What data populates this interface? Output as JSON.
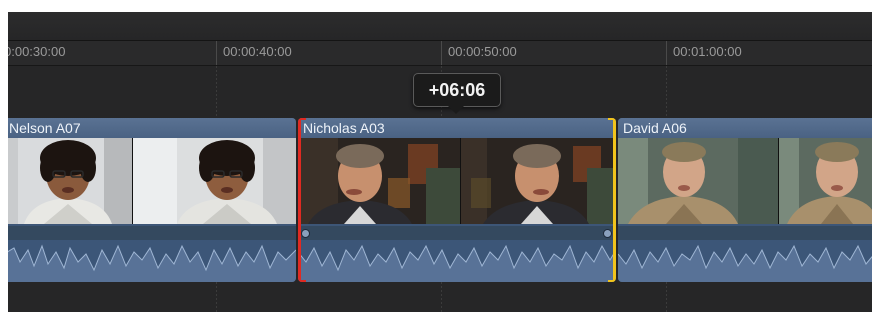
{
  "ruler": {
    "ticks": [
      "0:00:30:00",
      "00:00:40:00",
      "00:00:50:00",
      "00:01:00:00"
    ]
  },
  "tooltip": {
    "text": "+06:06"
  },
  "clips": [
    {
      "name": "Nelson A07",
      "accent": "#4a6283",
      "subject": "man-dark-curly-hair"
    },
    {
      "name": "Nicholas A03",
      "accent": "#4a6283",
      "subject": "man-grey-hair-suit",
      "selected": true
    },
    {
      "name": "David A06",
      "accent": "#4a6283",
      "subject": "man-beige-jacket"
    }
  ],
  "colors": {
    "clip_blue": "#3d5677",
    "selection_left": "#e02a22",
    "selection_right": "#f2c41c",
    "timeline_bg": "#262627"
  }
}
